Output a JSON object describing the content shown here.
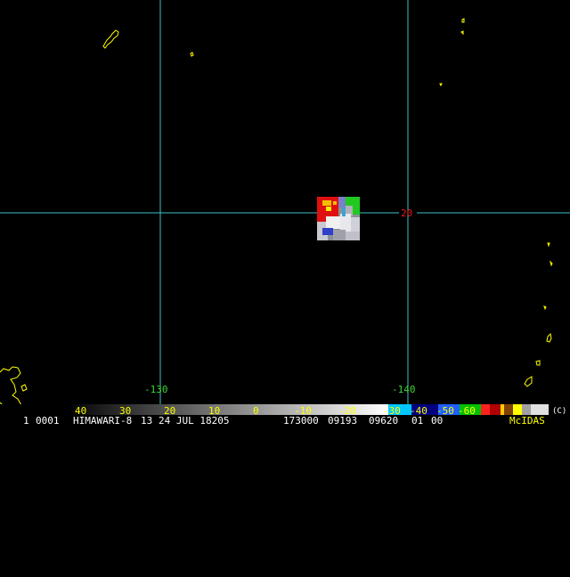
{
  "map": {
    "longitude_labels": [
      "-130",
      "-140"
    ],
    "latitude_labels": [
      "20"
    ],
    "colors": {
      "gridline": "#3fbfc8",
      "coastline": "#ffff00",
      "longitude_label": "#39d639",
      "latitude_label": "#e02020"
    }
  },
  "colorbar": {
    "tick_labels": [
      "40",
      "30",
      "20",
      "10",
      "0",
      "-10",
      "-20",
      "-30",
      "-40",
      "-50",
      "-60"
    ],
    "copyright": "(C)"
  },
  "info": {
    "frame": "1",
    "sequence": "0001",
    "satellite": "HIMAWARI-8",
    "band": "13",
    "date": "24 JUL 18205",
    "time": "173000",
    "line": "09193",
    "element": "09620",
    "res": "01",
    "mag": "00",
    "software": "McIDAS"
  }
}
